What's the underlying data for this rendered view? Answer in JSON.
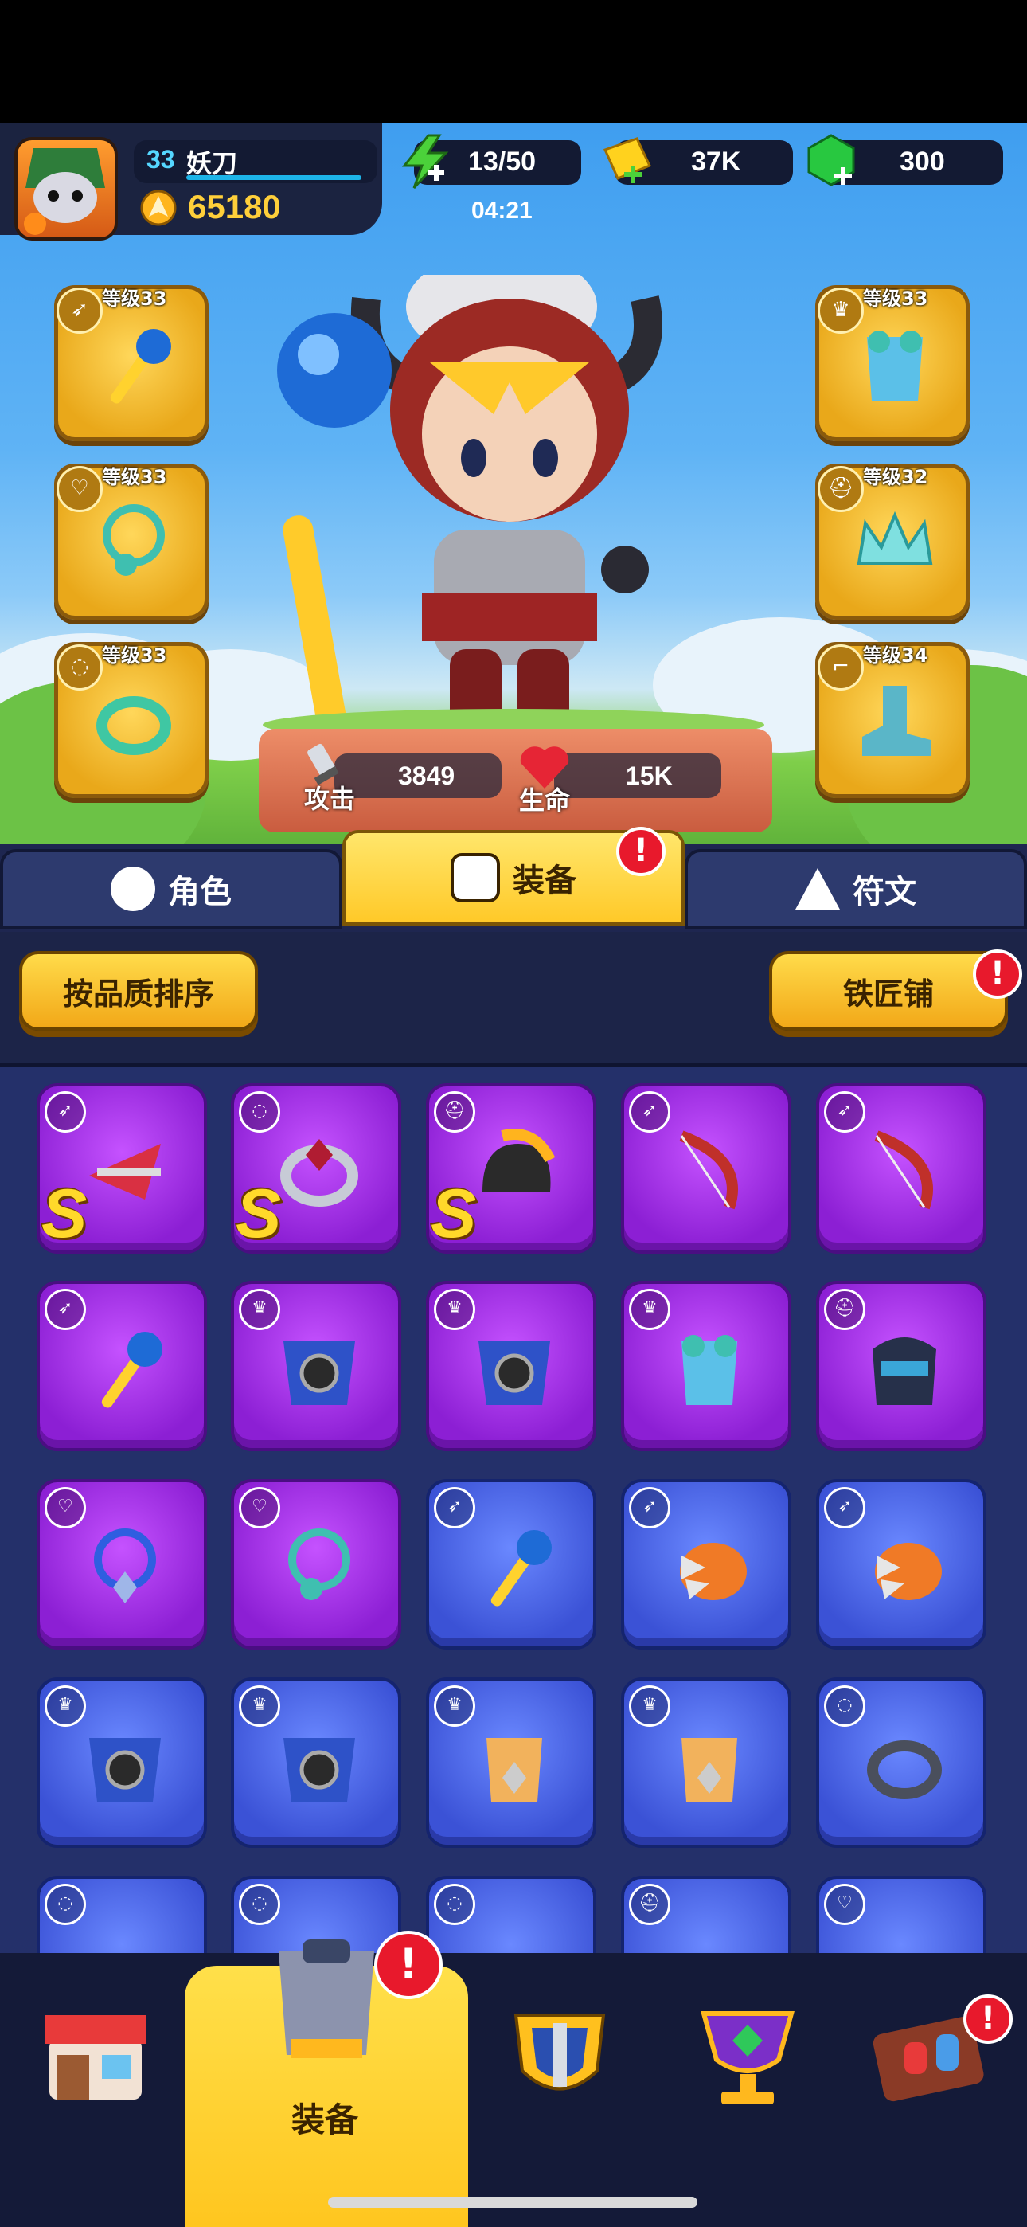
{
  "player": {
    "level": "33",
    "name": "妖刀",
    "power": "65180"
  },
  "resources": {
    "energy": "13/50",
    "energy_timer": "04:21",
    "gold": "37K",
    "gems": "300"
  },
  "slots": [
    {
      "label": "等级33",
      "icon": "staff-icon"
    },
    {
      "label": "等级33",
      "icon": "necklace-icon"
    },
    {
      "label": "等级33",
      "icon": "ring-icon"
    },
    {
      "label": "等级33",
      "icon": "armor-icon"
    },
    {
      "label": "等级32",
      "icon": "crown-icon"
    },
    {
      "label": "等级34",
      "icon": "boots-icon"
    }
  ],
  "stats": {
    "attack_label": "攻击",
    "attack": "3849",
    "hp_label": "生命",
    "hp": "15K"
  },
  "tabs": [
    {
      "label": "角色"
    },
    {
      "label": "装备"
    },
    {
      "label": "符文"
    }
  ],
  "toolbar": {
    "sort_label": "按品质排序",
    "smith_label": "铁匠铺"
  },
  "badge": "!",
  "inventory_grade": "S",
  "bottom_nav": {
    "active_label": "装备"
  },
  "colors": {
    "epic": "#9b2ee0",
    "rare": "#4a62e6",
    "gold": "#ffc928",
    "alert": "#e8192c"
  }
}
